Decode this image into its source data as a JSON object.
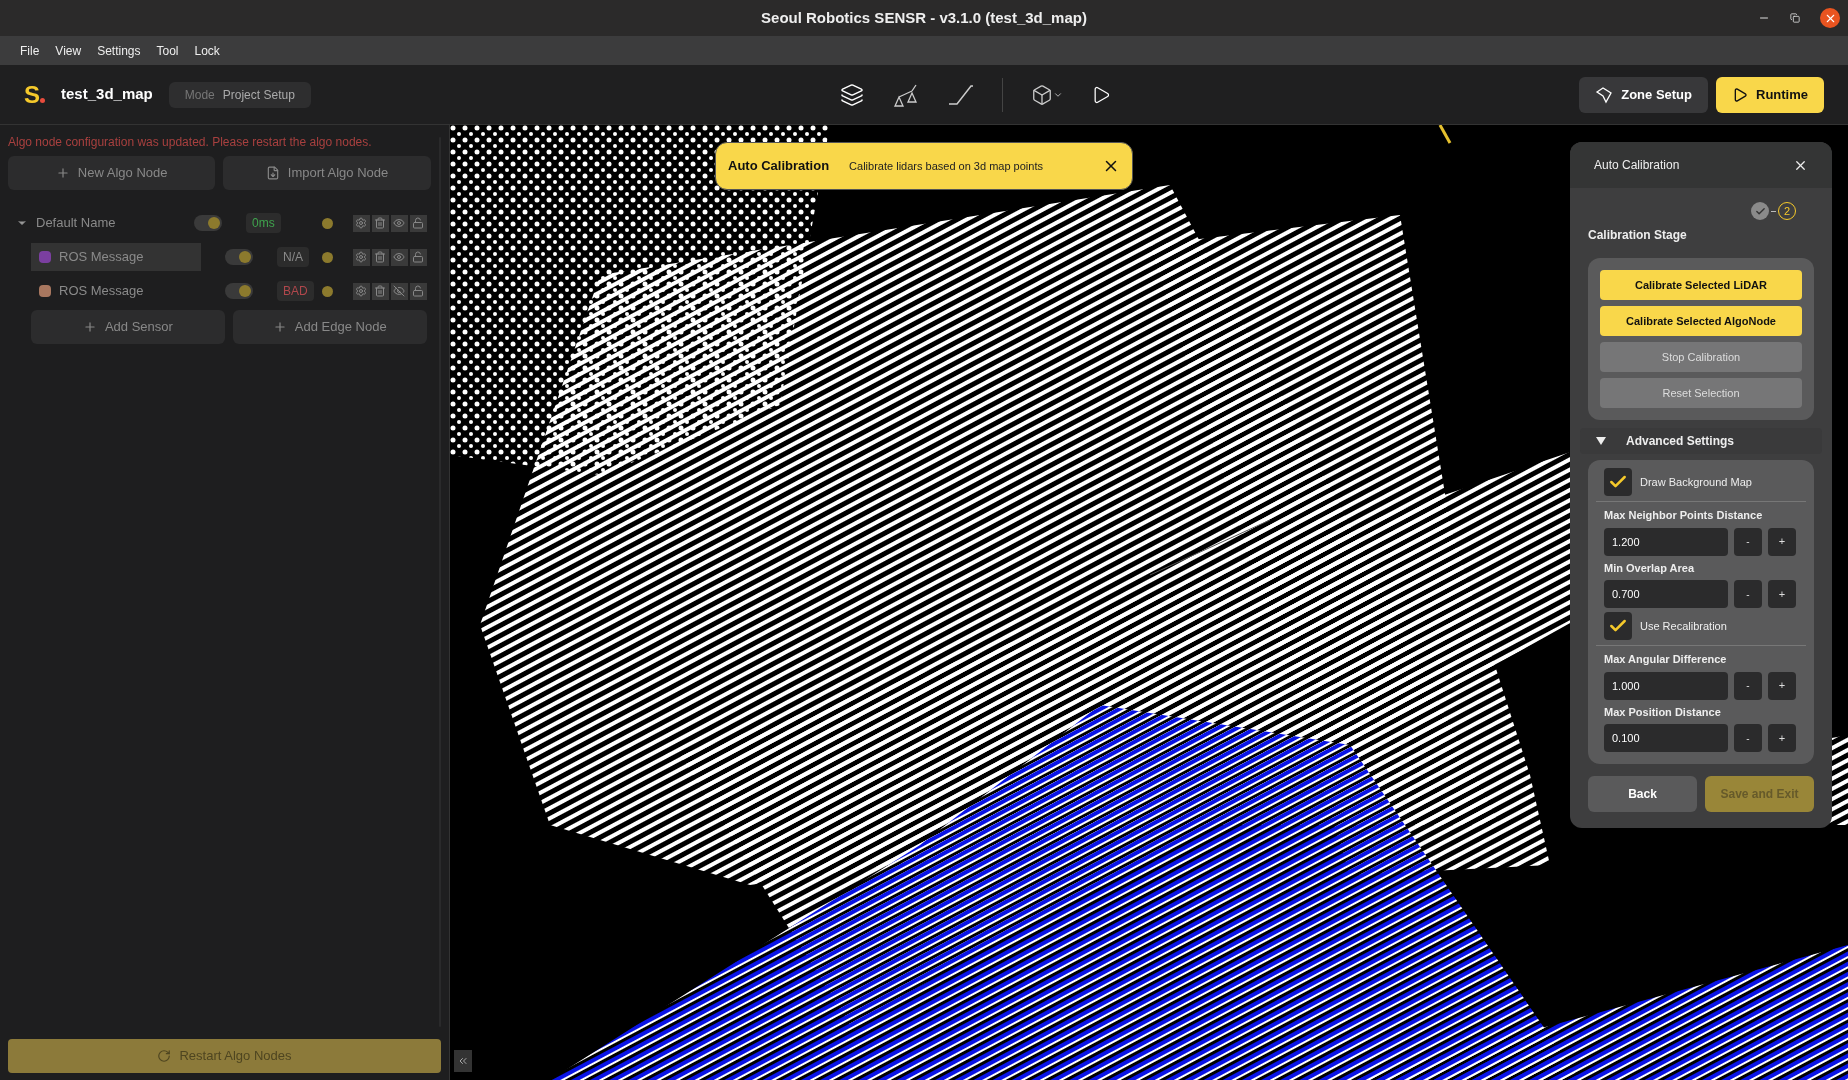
{
  "window": {
    "title": "Seoul Robotics SENSR - v3.1.0 (test_3d_map)"
  },
  "menu": [
    "File",
    "View",
    "Settings",
    "Tool",
    "Lock"
  ],
  "header": {
    "logo": "S",
    "project": "test_3d_map",
    "mode_label": "Mode",
    "mode": "Project Setup",
    "zone_button": "Zone Setup",
    "runtime_button": "Runtime"
  },
  "left_panel": {
    "warning": "Algo node configuration was updated. Please restart the algo nodes.",
    "buttons": [
      "New Algo Node",
      "Import Algo Node"
    ],
    "nodes": [
      {
        "name": "Default Name",
        "expanded": true,
        "on": true,
        "status": {
          "text": "0ms",
          "color": "#3fa34d"
        },
        "visible": true,
        "children": [
          {
            "name": "ROS Message",
            "color": "#7b3fa0",
            "selected": true,
            "on": true,
            "status": {
              "text": "N/A",
              "color": "#8a8a8a"
            },
            "visible": true
          },
          {
            "name": "ROS Message",
            "color": "#a8775f",
            "selected": false,
            "on": true,
            "status": {
              "text": "BAD",
              "color": "#b0474c"
            },
            "visible": false
          }
        ]
      }
    ],
    "add_buttons": [
      "Add Sensor",
      "Add Edge Node"
    ],
    "restart_button": "Restart Algo Nodes"
  },
  "toast": {
    "title": "Auto Calibration",
    "message": "Calibrate lidars based on 3d map points"
  },
  "calibration_panel": {
    "title": "Auto Calibration",
    "steps": [
      {
        "done": true
      },
      {
        "done": false,
        "label": "2"
      }
    ],
    "stage_title": "Calibration Stage",
    "stage_buttons": [
      {
        "label": "Calibrate Selected LiDAR",
        "primary": true
      },
      {
        "label": "Calibrate Selected AlgoNode",
        "primary": true
      },
      {
        "label": "Stop Calibration",
        "primary": false
      },
      {
        "label": "Reset Selection",
        "primary": false
      }
    ],
    "advanced": {
      "title": "Advanced Settings",
      "expanded": true,
      "items": [
        {
          "kind": "checkbox",
          "label": "Draw Background Map",
          "checked": true
        },
        {
          "kind": "number",
          "label": "Max Neighbor Points Distance",
          "value": "1.200"
        },
        {
          "kind": "number",
          "label": "Min Overlap Area",
          "value": "0.700"
        },
        {
          "kind": "checkbox",
          "label": "Use Recalibration",
          "checked": true
        },
        {
          "kind": "number",
          "label": "Max Angular Difference",
          "value": "1.000"
        },
        {
          "kind": "number",
          "label": "Max Position Distance",
          "value": "0.100"
        }
      ]
    },
    "minus": "-",
    "plus": "+",
    "back_button": "Back",
    "save_button": {
      "label": "Save and Exit",
      "disabled": true
    }
  }
}
